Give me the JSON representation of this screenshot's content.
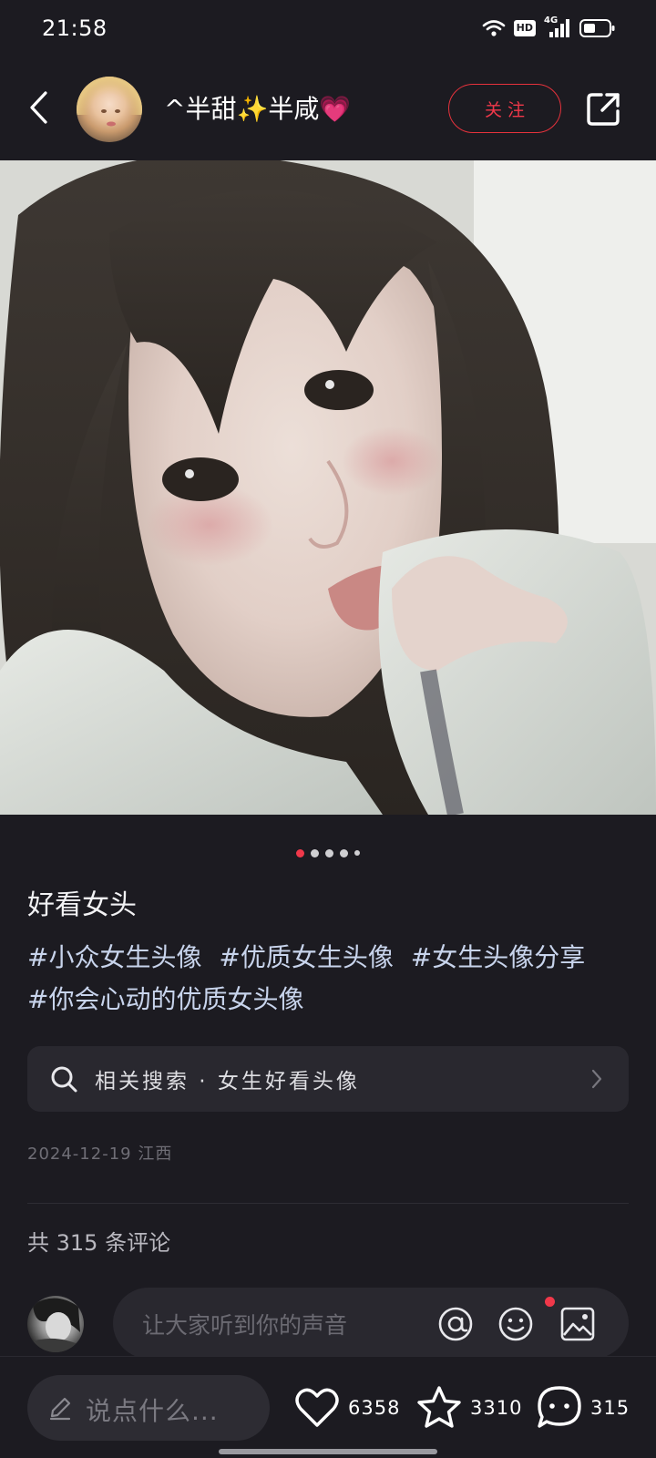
{
  "status_bar": {
    "time": "21:58",
    "hd_label": "HD",
    "network_label": "4G"
  },
  "header": {
    "username": "^半甜✨半咸💗",
    "follow_label": "关注"
  },
  "pager": {
    "total": 5,
    "current": 1
  },
  "post": {
    "title": "好看女头",
    "tags": [
      "#小众女生头像",
      "#优质女生头像",
      "#女生头像分享",
      "#你会心动的优质女头像"
    ],
    "related_search_label": "相关搜索 · 女生好看头像",
    "date": "2024-12-19",
    "location": "江西"
  },
  "comments": {
    "count_text": "共 315 条评论",
    "input_placeholder": "让大家听到你的声音"
  },
  "bottom_bar": {
    "say_placeholder": "说点什么...",
    "likes": "6358",
    "favorites": "3310",
    "comments": "315"
  },
  "colors": {
    "background": "#1c1b21",
    "accent": "#f0384a",
    "tag_text": "#c8d4ec",
    "input_bg": "#29282f"
  },
  "icons": {
    "back": "chevron-left-icon",
    "share": "share-external-icon",
    "search": "search-icon",
    "mention": "at-icon",
    "emoji": "emoji-icon",
    "image": "image-icon",
    "like": "heart-icon",
    "favorite": "star-icon",
    "comment": "comment-icon",
    "edit": "pencil-icon"
  }
}
